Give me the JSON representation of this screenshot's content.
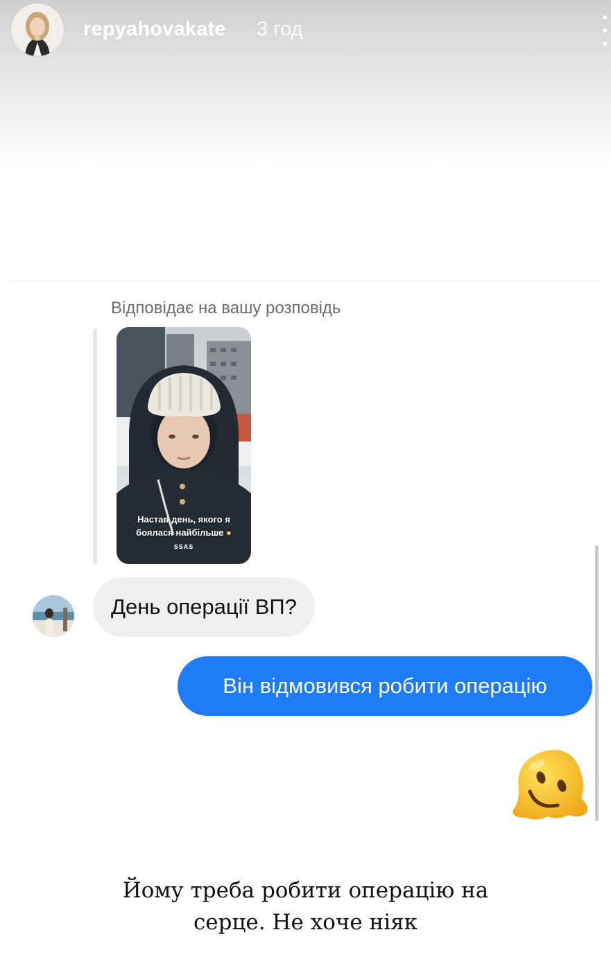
{
  "header": {
    "username": "repyahovakate",
    "time": "3 год"
  },
  "reply": {
    "label": "Відповідає на вашу розповідь",
    "story_caption_line1": "Настав день, якого я",
    "story_caption_line2": "боялася найбільше",
    "story_caption_dots": "SSAS"
  },
  "messages": [
    {
      "from": "other",
      "text": "День операції ВП?"
    },
    {
      "from": "self",
      "text": "Він відмовився робити операцію"
    },
    {
      "from": "self",
      "emoji": "melting-face"
    }
  ],
  "story_text": {
    "line1": "Йому треба робити операцію на",
    "line2": "серце. Не хоче ніяк"
  },
  "colors": {
    "outgoing_bubble": "#1f7cf7",
    "incoming_bubble": "#efefef",
    "emoji_yellow": "#f7c51e"
  }
}
